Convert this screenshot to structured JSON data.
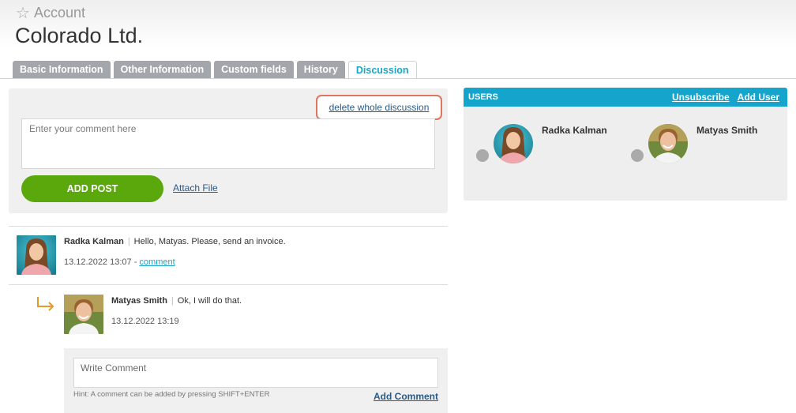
{
  "header": {
    "object_type": "Account",
    "title": "Colorado Ltd."
  },
  "tabs": [
    {
      "label": "Basic Information",
      "active": false
    },
    {
      "label": "Other Information",
      "active": false
    },
    {
      "label": "Custom fields",
      "active": false
    },
    {
      "label": "History",
      "active": false
    },
    {
      "label": "Discussion",
      "active": true
    }
  ],
  "composer": {
    "delete_label": "delete whole discussion",
    "placeholder": "Enter your comment here",
    "add_post_label": "ADD POST",
    "attach_label": "Attach File"
  },
  "thread": {
    "posts": [
      {
        "author": "Radka Kalman",
        "message": "Hello, Matyas. Please, send an invoice.",
        "timestamp": "13.12.2022 13:07",
        "meta_sep": " - ",
        "action": "comment"
      }
    ],
    "replies": [
      {
        "author": "Matyas Smith",
        "message": "Ok, I will do that.",
        "timestamp": "13.12.2022 13:19"
      }
    ],
    "reply_box": {
      "placeholder": "Write Comment",
      "hint": "Hint: A comment can be added by pressing SHIFT+ENTER",
      "add_label": "Add Comment"
    }
  },
  "users": {
    "title": "USERS",
    "unsubscribe_label": "Unsubscribe",
    "add_user_label": "Add User",
    "list": [
      {
        "name": "Radka Kalman",
        "status_color": "#aaaaaa"
      },
      {
        "name": "Matyas Smith",
        "status_color": "#aaaaaa"
      }
    ]
  },
  "colors": {
    "accent": "#14a4cc",
    "primary_button": "#5aa80c",
    "highlight_outline": "#e0755f",
    "tab_inactive": "#a3a6aa"
  },
  "icons": {
    "favorite": "star-outline-icon",
    "reply": "reply-arrow-icon"
  }
}
